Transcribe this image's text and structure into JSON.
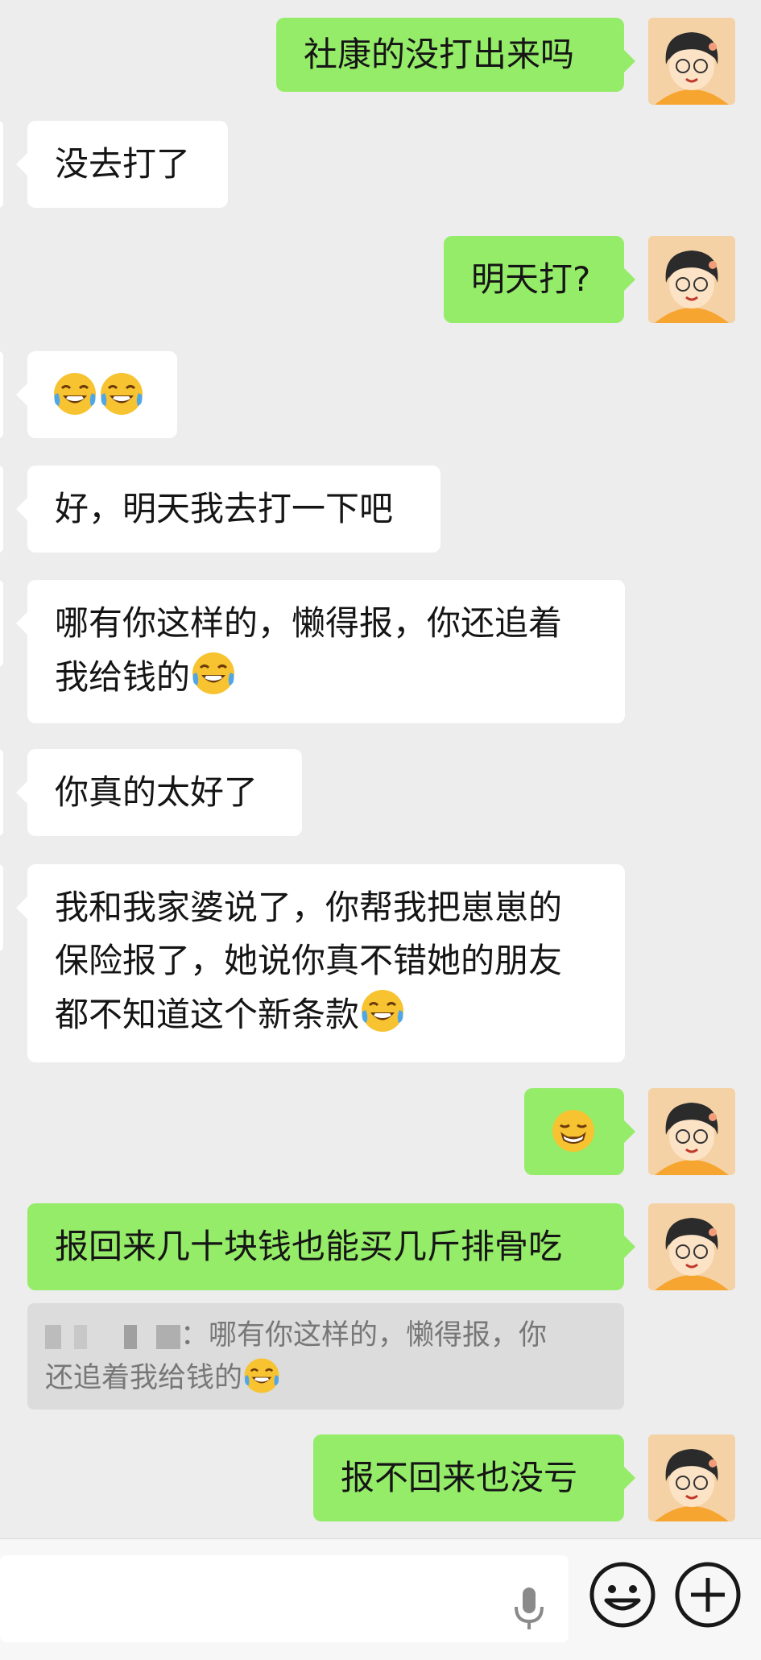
{
  "messages": [
    {
      "side": "out",
      "text": "社康的没打出来吗"
    },
    {
      "side": "in",
      "text": "没去打了"
    },
    {
      "side": "out",
      "text": "明天打?"
    },
    {
      "side": "in",
      "emojis": [
        "laughing-tears",
        "laughing-tears"
      ]
    },
    {
      "side": "in",
      "text": "好，明天我去打一下吧"
    },
    {
      "side": "in",
      "lines": [
        "哪有你这样的，懒得报，你还追着",
        "我给钱的"
      ],
      "trailing_emoji": "laughing-tears"
    },
    {
      "side": "in",
      "text": "你真的太好了"
    },
    {
      "side": "in",
      "lines": [
        "我和我家婆说了，你帮我把崽崽的",
        "保险报了，她说你真不错她的朋友",
        "都不知道这个新条款"
      ],
      "trailing_emoji": "laughing-tears"
    },
    {
      "side": "out",
      "emojis": [
        "grin-smirk"
      ]
    },
    {
      "side": "out",
      "text": "报回来几十块钱也能买几斤排骨吃"
    },
    {
      "side": "out",
      "text": "报不回来也没亏"
    }
  ],
  "quote": {
    "sender_suffix": "：哪有你这样的，懒得报，你",
    "line2": "还追着我给钱的",
    "emoji": "laughing-tears"
  },
  "bottom_bar": {
    "mic_icon": "microphone-icon",
    "emoji_icon": "smiley-face-icon",
    "plus_icon": "plus-circle-icon"
  },
  "colors": {
    "background": "#ededed",
    "outgoing_bubble": "#95ec69",
    "incoming_bubble": "#ffffff",
    "avatar_bg": "#f5d2a6"
  }
}
